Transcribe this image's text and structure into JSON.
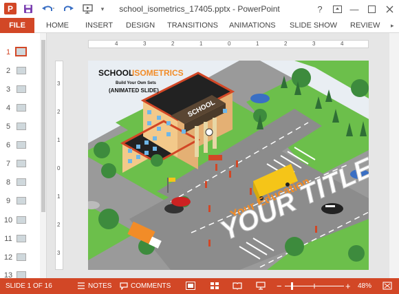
{
  "titlebar": {
    "app_icon_letter": "P",
    "title": "school_isometrics_17405.pptx - PowerPoint",
    "help_label": "?",
    "minimize_label": "—"
  },
  "ribbon": {
    "tabs": [
      "FILE",
      "HOME",
      "INSERT",
      "DESIGN",
      "TRANSITIONS",
      "ANIMATIONS",
      "SLIDE SHOW",
      "REVIEW"
    ]
  },
  "thumbnails": {
    "numbers": [
      "1",
      "2",
      "3",
      "4",
      "5",
      "6",
      "7",
      "8",
      "9",
      "10",
      "11",
      "12",
      "13"
    ],
    "active": "1"
  },
  "rulers": {
    "top": [
      "4",
      "3",
      "2",
      "1",
      "0",
      "1",
      "2",
      "3",
      "4"
    ],
    "left": [
      "3",
      "2",
      "1",
      "0",
      "1",
      "2",
      "3"
    ]
  },
  "slide": {
    "heading_school": "SCHOOL",
    "heading_isometrics": "ISOMETRICS",
    "subtitle": "Build Your Own Sets",
    "note": "(ANIMATED SLIDE)",
    "building_sign": "SCHOOL",
    "tagline": "Your Education",
    "big_title": "YOUR TITLE"
  },
  "statusbar": {
    "slide_info": "SLIDE 1 OF 16",
    "notes_label": "NOTES",
    "comments_label": "COMMENTS",
    "zoom_minus": "−",
    "zoom_plus": "+",
    "zoom_level": "48%"
  },
  "colors": {
    "accent": "#d24726",
    "grass": "#6cbf4b",
    "road": "#8a8a8a",
    "title_orange": "#f28c28",
    "sky": "#e7eef5"
  }
}
